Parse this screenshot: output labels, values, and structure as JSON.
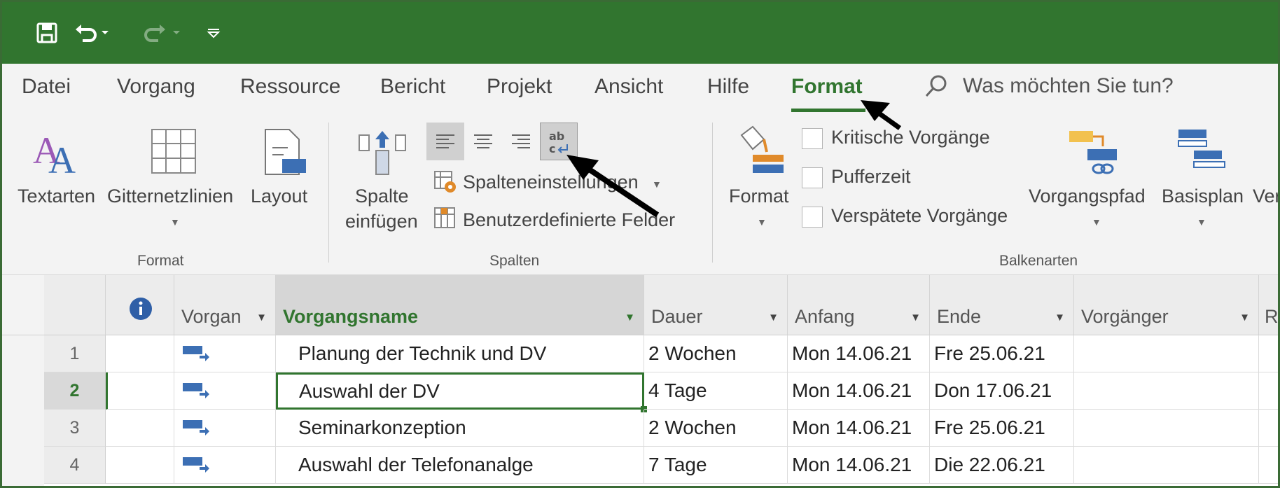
{
  "tabs": [
    "Datei",
    "Vorgang",
    "Ressource",
    "Bericht",
    "Projekt",
    "Ansicht",
    "Hilfe",
    "Format"
  ],
  "tell_me": "Was möchten Sie tun?",
  "ribbon": {
    "format_group": {
      "label": "Format",
      "textarten": "Textarten",
      "gitternetzlinien": "Gitternetzlinien",
      "layout": "Layout"
    },
    "spalten_group": {
      "label": "Spalten",
      "spalte_einfuegen_1": "Spalte",
      "spalte_einfuegen_2": "einfügen",
      "spalteneinstellungen": "Spalteneinstellungen",
      "benutzerdefinierte_felder": "Benutzerdefinierte Felder"
    },
    "balkenarten_group": {
      "label": "Balkenarten",
      "format": "Format",
      "kritische": "Kritische Vorgänge",
      "pufferzeit": "Pufferzeit",
      "verspaetete": "Verspätete Vorgänge",
      "vorgangspfad": "Vorgangspfad",
      "basisplan": "Basisplan",
      "cut_off": "Ver"
    }
  },
  "grid": {
    "columns": [
      "Vorgan",
      "Vorgangsname",
      "Dauer",
      "Anfang",
      "Ende",
      "Vorgänger",
      "R"
    ],
    "rows": [
      {
        "num": "1",
        "name": "Planung der Technik und DV",
        "dauer": "2 Wochen",
        "anfang": "Mon 14.06.21",
        "ende": "Fre 25.06.21"
      },
      {
        "num": "2",
        "name": "Auswahl der DV",
        "dauer": "4 Tage",
        "anfang": "Mon 14.06.21",
        "ende": "Don 17.06.21"
      },
      {
        "num": "3",
        "name": "Seminarkonzeption",
        "dauer": "2 Wochen",
        "anfang": "Mon 14.06.21",
        "ende": "Fre 25.06.21"
      },
      {
        "num": "4",
        "name": "Auswahl der Telefonanalge",
        "dauer": "7 Tage",
        "anfang": "Mon 14.06.21",
        "ende": "Die 22.06.21"
      }
    ]
  },
  "colors": {
    "accent": "#31752f",
    "titlebar": "#31752f",
    "ribbon_bg": "#f3f3f3"
  }
}
